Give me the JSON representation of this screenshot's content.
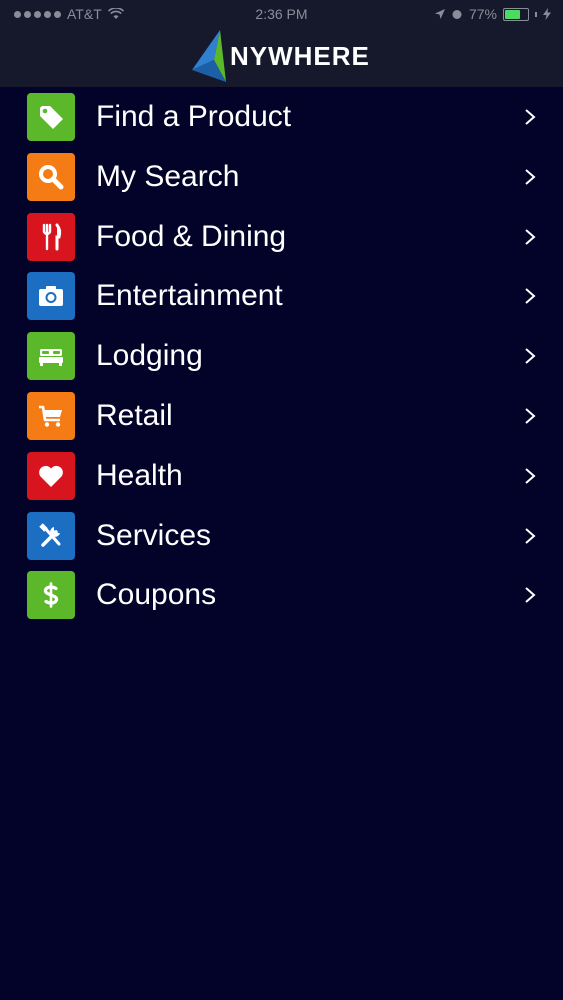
{
  "status_bar": {
    "carrier": "AT&T",
    "time": "2:36 PM",
    "battery_percent": "77%",
    "battery_level": 0.77
  },
  "header": {
    "logo_text": "NYWHERE"
  },
  "menu": {
    "items": [
      {
        "label": "Find a Product",
        "icon": "tag-icon",
        "color": "#5bb82b"
      },
      {
        "label": "My Search",
        "icon": "search-icon",
        "color": "#f57c14"
      },
      {
        "label": "Food & Dining",
        "icon": "fork-knife-icon",
        "color": "#d8141f"
      },
      {
        "label": "Entertainment",
        "icon": "camera-icon",
        "color": "#1b6ec2"
      },
      {
        "label": "Lodging",
        "icon": "bed-icon",
        "color": "#5bb82b"
      },
      {
        "label": "Retail",
        "icon": "shopping-cart-icon",
        "color": "#f57c14"
      },
      {
        "label": "Health",
        "icon": "heart-icon",
        "color": "#d8141f"
      },
      {
        "label": "Services",
        "icon": "tools-icon",
        "color": "#1b6ec2"
      },
      {
        "label": "Coupons",
        "icon": "dollar-icon",
        "color": "#5bb82b"
      }
    ]
  }
}
